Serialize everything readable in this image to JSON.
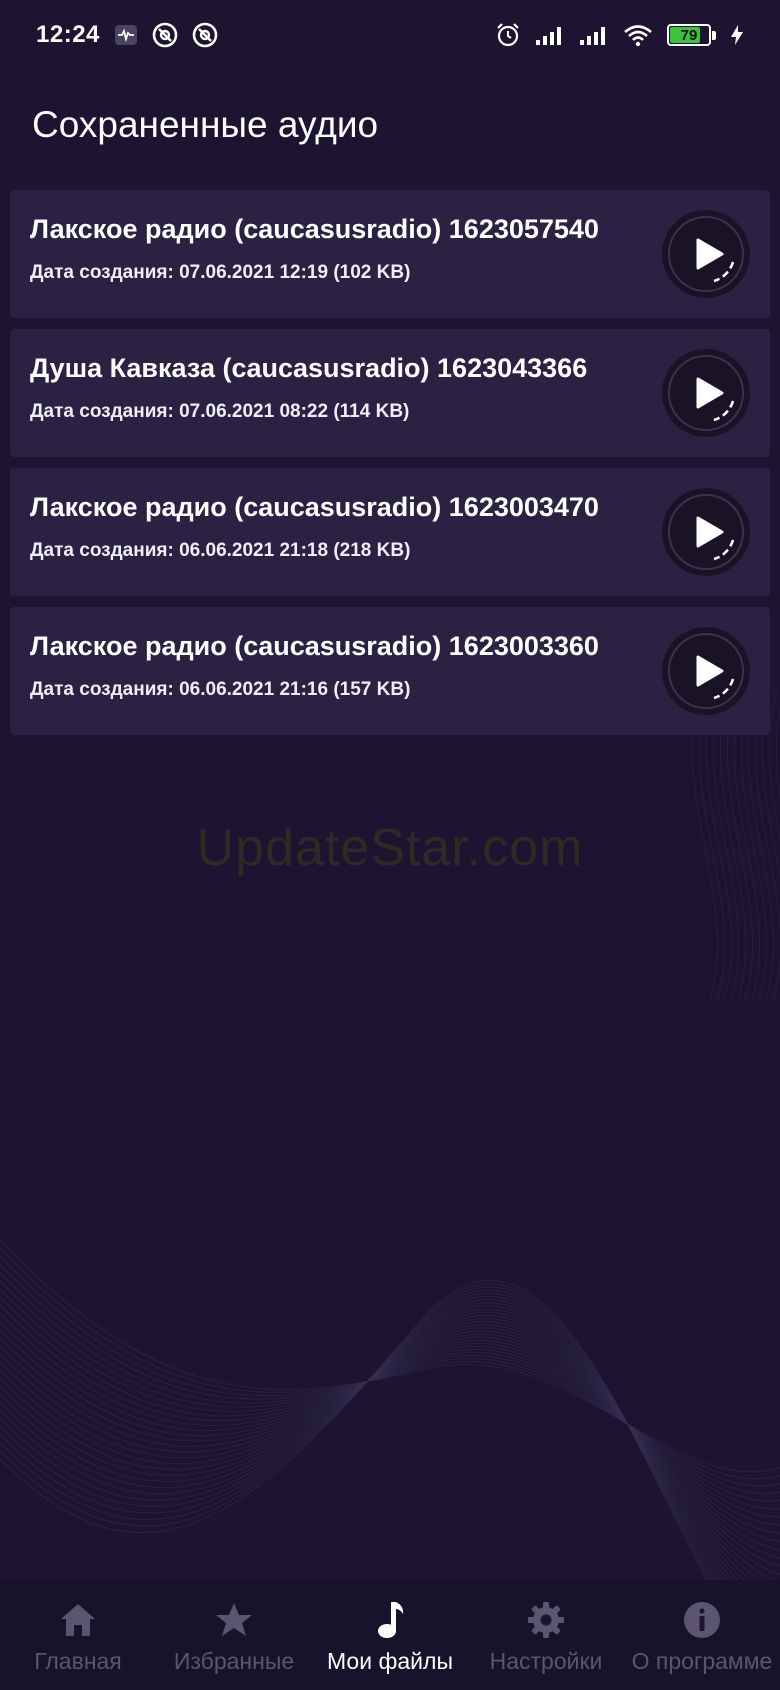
{
  "status_bar": {
    "time": "12:24",
    "battery_level": "79",
    "left_icons": [
      "activity-icon",
      "at-icon",
      "at-icon"
    ],
    "right_icons": [
      "alarm-icon",
      "signal-icon",
      "signal-icon",
      "wifi-icon",
      "battery-icon",
      "charging-icon"
    ]
  },
  "page": {
    "title": "Сохраненные аудио"
  },
  "recordings": [
    {
      "title": "Лакское радио (caucasusradio) 1623057540",
      "meta": "Дата создания: 07.06.2021 12:19 (102 KB)"
    },
    {
      "title": "Душа Кавказа (caucasusradio) 1623043366",
      "meta": "Дата создания: 07.06.2021 08:22 (114 KB)"
    },
    {
      "title": "Лакское радио (caucasusradio) 1623003470",
      "meta": "Дата создания: 06.06.2021 21:18 (218 KB)"
    },
    {
      "title": "Лакское радио (caucasusradio) 1623003360",
      "meta": "Дата создания: 06.06.2021 21:16 (157 KB)"
    }
  ],
  "watermark": "UpdateStar.com",
  "nav": {
    "items": [
      {
        "label": "Главная",
        "icon": "home-icon",
        "active": false
      },
      {
        "label": "Избранные",
        "icon": "star-icon",
        "active": false
      },
      {
        "label": "Мои файлы",
        "icon": "music-note-icon",
        "active": true
      },
      {
        "label": "Настройки",
        "icon": "gear-icon",
        "active": false
      },
      {
        "label": "О программе",
        "icon": "info-icon",
        "active": false
      }
    ]
  },
  "colors": {
    "background": "#1c1430",
    "card": "#2b2142",
    "battery": "#3cc33c",
    "nav_inactive": "#5c5571",
    "nav_active": "#ffffff"
  }
}
